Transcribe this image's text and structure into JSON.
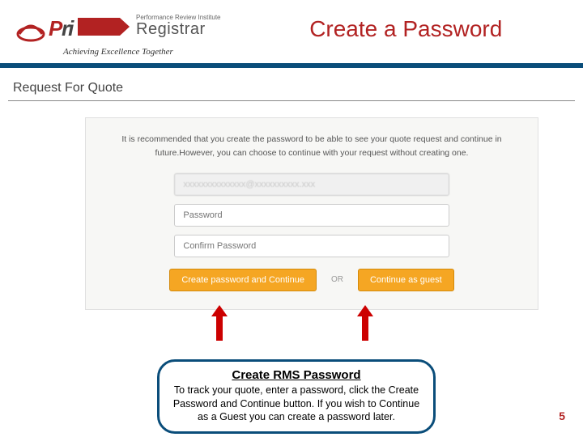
{
  "header": {
    "org_name_top": "Performance Review Institute",
    "org_name_main": "Registrar",
    "tagline": "Achieving Excellence Together",
    "slide_title": "Create a Password"
  },
  "section": {
    "title": "Request For Quote"
  },
  "form": {
    "instruction": "It is recommended that you create the password to be able to see your quote request and continue in future.However, you can choose to continue with your request without creating one.",
    "email_value": "xxxxxxxxxxxxxx@xxxxxxxxxx.xxx",
    "password_placeholder": "Password",
    "confirm_placeholder": "Confirm Password",
    "create_btn": "Create password and Continue",
    "or_label": "OR",
    "guest_btn": "Continue as guest"
  },
  "callout": {
    "title": "Create RMS Password",
    "body": "To track your quote, enter a password, click the Create Password and Continue button.\nIf you wish to Continue as a Guest you can create a password later."
  },
  "page_number": "5"
}
